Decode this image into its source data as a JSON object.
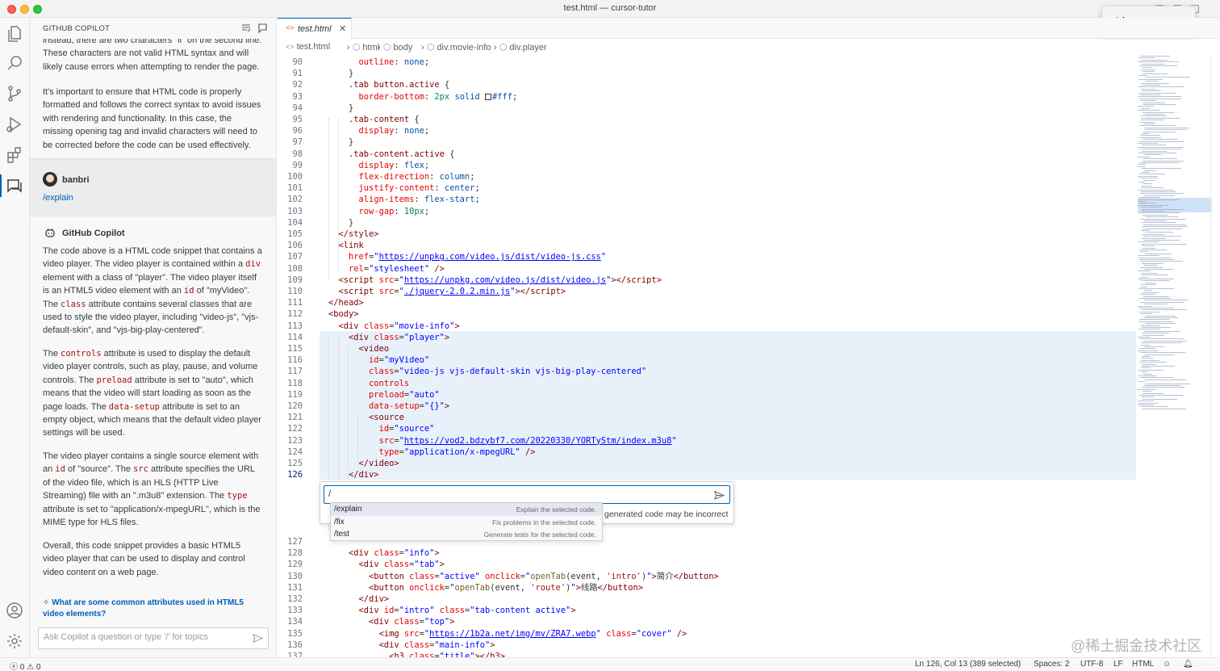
{
  "window": {
    "title": "test.html — cursor-tutor"
  },
  "ime": {
    "text": "Abc"
  },
  "sidebar": {
    "title": "GITHUB COPILOT",
    "intro_paragraphs": [
      "instead, there are two characters \"ll\" on the second line. These characters are not valid HTML syntax and will likely cause errors when attempting to render the page.",
      "It's important to ensure that HTML code is properly formatted and follows the correct syntax to avoid issues with rendering and functionality. In this case, the missing opening tag and invalid characters will need to be corrected before the code can be used effectively."
    ],
    "user": {
      "name": "banbri",
      "command": "/explain"
    },
    "copilot": {
      "name": "GitHub Copilot"
    },
    "answer": {
      "p1": [
        "The code above is a HTML code snippet that contains a video player. The video player is contained within a ",
        "div",
        " element with a class of \"player\". The video player itself is an HTML5 video element with an ",
        "id",
        " of \"myVideo\". The ",
        "class",
        " attribute contains several classes that are used to style the video player, including \"video-js\", \"vjs-default-skin\", and \"vjs-big-play-centered\"."
      ],
      "p2": [
        "The ",
        "controls",
        " attribute is used to display the default video player controls, such as play, pause, and volume controls. The ",
        "preload",
        " attribute is set to \"auto\", which means that the video will start loading as soon as the page loads. The ",
        "data-setup",
        " attribute is set to an empty object, which means that the default video player settings will be used."
      ],
      "p3": [
        "The video player contains a single source element with an ",
        "id",
        " of \"source\". The ",
        "src",
        " attribute specifies the URL of the video file, which is an HLS (HTTP Live Streaming) file with an \".m3u8\" extension. The ",
        "type",
        " attribute is set to \"application/x-mpegURL\", which is the MIME type for HLS files."
      ],
      "p4": "Overall, this code snippet provides a basic HTML5 video player that can be used to display and control video content on a web page."
    },
    "followup": "What are some common attributes used in HTML5 video elements?",
    "input_placeholder": "Ask Copilot a question or type '/' for topics"
  },
  "tab": {
    "label": "test.html",
    "icon": "<>"
  },
  "breadcrumb": [
    "test.html",
    "html",
    "body",
    "div.movie-info",
    "div.player"
  ],
  "editor": {
    "current_line": "126",
    "lines": [
      {
        "n": "90",
        "html": "      <span class='c-prop'>outline</span>: <span class='c-val'>none</span>;"
      },
      {
        "n": "91",
        "html": "    }"
      },
      {
        "n": "92",
        "html": "    <span class='c-sel'>.tab button.active</span> {"
      },
      {
        "n": "93",
        "html": "      <span class='c-prop'>border-bottom</span>: <span class='c-num'>2px</span> <span class='c-val'>solid</span> <span class='swatch' style='background:#fff'></span><span class='c-val'>#fff</span>;"
      },
      {
        "n": "94",
        "html": "    }"
      },
      {
        "n": "95",
        "html": "    <span class='c-sel'>.tab-content</span> {"
      },
      {
        "n": "96",
        "html": "      <span class='c-prop'>display</span>: <span class='c-val'>none</span>;"
      },
      {
        "n": "97",
        "html": "    }"
      },
      {
        "n": "98",
        "html": "    <span class='c-sel'>.tab-content.active</span> {"
      },
      {
        "n": "99",
        "html": "      <span class='c-prop'>display</span>: <span class='c-val'>flex</span>;"
      },
      {
        "n": "100",
        "html": "      <span class='c-prop'>flex-direction</span>: <span class='c-val'>column</span>;"
      },
      {
        "n": "101",
        "html": "      <span class='c-prop'>justify-content</span>: <span class='c-val'>center</span>;"
      },
      {
        "n": "102",
        "html": "      <span class='c-prop'>align-items</span>: <span class='c-val'>flex-start</span>;"
      },
      {
        "n": "103",
        "html": "      <span class='c-prop'>row-gap</span>: <span class='c-num'>10px</span>;"
      },
      {
        "n": "104",
        "html": "    }"
      },
      {
        "n": "105",
        "html": "  <span class='c-tag'>&lt;/style&gt;</span>"
      },
      {
        "n": "106",
        "html": "  <span class='c-tag'>&lt;link</span>"
      },
      {
        "n": "107",
        "html": "    <span class='c-attr'>href</span>=<span class='c-str'>\"</span><span class='c-url'>https://unpkg.com/video.js/dist/video-js.css</span><span class='c-str'>\"</span>"
      },
      {
        "n": "108",
        "html": "    <span class='c-attr'>rel</span>=<span class='c-str'>\"stylesheet\"</span> <span class='c-tag'>/&gt;</span>"
      },
      {
        "n": "109",
        "html": "  <span class='c-tag'>&lt;script</span> <span class='c-attr'>src</span>=<span class='c-str'>\"</span><span class='c-url'>https://unpkg.com/video.js/dist/video.js</span><span class='c-str'>\"</span><span class='c-tag'>&gt;&lt;/script&gt;</span>"
      },
      {
        "n": "110",
        "html": "  <span class='c-tag'>&lt;script</span> <span class='c-attr'>src</span>=<span class='c-str'>\"</span><span class='c-url'>./jquery-2.0.2.min.js</span><span class='c-str'>\"</span><span class='c-tag'>&gt;&lt;/script&gt;</span>"
      },
      {
        "n": "111",
        "html": "<span class='c-tag'>&lt;/head&gt;</span>"
      },
      {
        "n": "112",
        "html": "<span class='c-tag'>&lt;body&gt;</span>"
      },
      {
        "n": "113",
        "html": "  <span class='c-tag'>&lt;div</span> <span class='c-attr'>class</span>=<span class='c-str'>\"movie-info\"</span><span class='c-tag'>&gt;</span>"
      },
      {
        "n": "114",
        "html": "    <span class='c-tag'>&lt;div</span> <span class='c-attr'>class</span>=<span class='c-str'>\"player\"</span><span class='c-tag'>&gt;</span>"
      },
      {
        "n": "115",
        "html": "      <span class='c-tag'>&lt;video</span>"
      },
      {
        "n": "116",
        "html": "        <span class='c-attr'>id</span>=<span class='c-str'>\"myVideo\"</span>"
      },
      {
        "n": "117",
        "html": "        <span class='c-attr'>class</span>=<span class='c-str'>\"video-js vjs-default-skin vjs-big-play-centered\"</span>"
      },
      {
        "n": "118",
        "html": "        <span class='c-attr'>controls</span>"
      },
      {
        "n": "119",
        "html": "        <span class='c-attr'>preload</span>=<span class='c-str'>\"auto\"</span>"
      },
      {
        "n": "120",
        "html": "        <span class='c-attr'>data-setup</span>=<span class='c-str'>\"{}\"</span><span class='c-tag'>&gt;</span>"
      },
      {
        "n": "121",
        "html": "        <span class='c-tag'>&lt;source</span>"
      },
      {
        "n": "122",
        "html": "          <span class='c-attr'>id</span>=<span class='c-str'>\"source\"</span>"
      },
      {
        "n": "123",
        "html": "          <span class='c-attr'>src</span>=<span class='c-str'>\"</span><span class='c-url'>https://vod2.bdzybf7.com/20220330/YORTyStm/index.m3u8</span><span class='c-str'>\"</span>"
      },
      {
        "n": "124",
        "html": "          <span class='c-attr'>type</span>=<span class='c-str'>\"application/x-mpegURL\"</span> <span class='c-tag'>/&gt;</span>"
      },
      {
        "n": "125",
        "html": "      <span class='c-tag'>&lt;/video&gt;</span>"
      },
      {
        "n": "126",
        "html": "    <span class='c-tag'>&lt;/div&gt;</span>"
      }
    ],
    "lines_after": [
      {
        "n": "127",
        "html": ""
      },
      {
        "n": "128",
        "html": "    <span class='c-tag'>&lt;div</span> <span class='c-attr'>class</span>=<span class='c-str'>\"info\"</span><span class='c-tag'>&gt;</span>"
      },
      {
        "n": "129",
        "html": "      <span class='c-tag'>&lt;div</span> <span class='c-attr'>class</span>=<span class='c-str'>\"tab\"</span><span class='c-tag'>&gt;</span>"
      },
      {
        "n": "130",
        "html": "        <span class='c-tag'>&lt;button</span> <span class='c-attr'>class</span>=<span class='c-str'>\"active\"</span> <span class='c-attr'>onclick</span>=<span class='c-str'>\"</span><span class='c-fn'>openTab</span><span class='c-punc'>(event, </span><span class='c-sq'>'intro'</span><span class='c-punc'>)</span><span class='c-str'>\"</span><span class='c-tag'>&gt;</span>简介<span class='c-tag'>&lt;/button&gt;</span>"
      },
      {
        "n": "131",
        "html": "        <span class='c-tag'>&lt;button</span> <span class='c-attr'>onclick</span>=<span class='c-str'>\"</span><span class='c-fn'>openTab</span><span class='c-punc'>(event, </span><span class='c-sq'>'route'</span><span class='c-punc'>)</span><span class='c-str'>\"</span><span class='c-tag'>&gt;</span>线路<span class='c-tag'>&lt;/button&gt;</span>"
      },
      {
        "n": "132",
        "html": "      <span class='c-tag'>&lt;/div&gt;</span>"
      },
      {
        "n": "133",
        "html": "      <span class='c-tag'>&lt;div</span> <span class='c-attr'>id</span>=<span class='c-str'>\"intro\"</span> <span class='c-attr'>class</span>=<span class='c-str'>\"tab-content active\"</span><span class='c-tag'>&gt;</span>"
      },
      {
        "n": "134",
        "html": "        <span class='c-tag'>&lt;div</span> <span class='c-attr'>class</span>=<span class='c-str'>\"top\"</span><span class='c-tag'>&gt;</span>"
      },
      {
        "n": "135",
        "html": "          <span class='c-tag'>&lt;img</span> <span class='c-attr'>src</span>=<span class='c-str'>\"</span><span class='c-url'>https://1b2a.net/img/mv/ZRA7.webp</span><span class='c-str'>\"</span> <span class='c-attr'>class</span>=<span class='c-str'>\"cover\"</span> <span class='c-tag'>/&gt;</span>"
      },
      {
        "n": "136",
        "html": "          <span class='c-tag'>&lt;div</span> <span class='c-attr'>class</span>=<span class='c-str'>\"main-info\"</span><span class='c-tag'>&gt;</span>"
      },
      {
        "n": "137",
        "html": "            <span class='c-tag'>&lt;h3</span> <span class='c-attr'>class</span>=<span class='c-str'>\"title\"</span><span class='c-tag'>&gt;&lt;/h3&gt;</span>"
      }
    ]
  },
  "inline_chat": {
    "value": "/",
    "note": "generated code may be incorrect",
    "suggestions": [
      {
        "cmd": "/explain",
        "desc": "Explain the selected code."
      },
      {
        "cmd": "/fix",
        "desc": "Fix problems in the selected code."
      },
      {
        "cmd": "/test",
        "desc": "Generate tests for the selected code."
      }
    ]
  },
  "statusbar": {
    "errors": "0",
    "warnings": "0",
    "position": "Ln 126, Col 13 (389 selected)",
    "spaces": "Spaces: 2",
    "encoding": "UTF-8",
    "eol": "LF",
    "language": "HTML"
  },
  "watermark": "@稀土掘金技术社区",
  "colors": {
    "accent": "#005fb8",
    "selection": "#e8f1fa"
  }
}
